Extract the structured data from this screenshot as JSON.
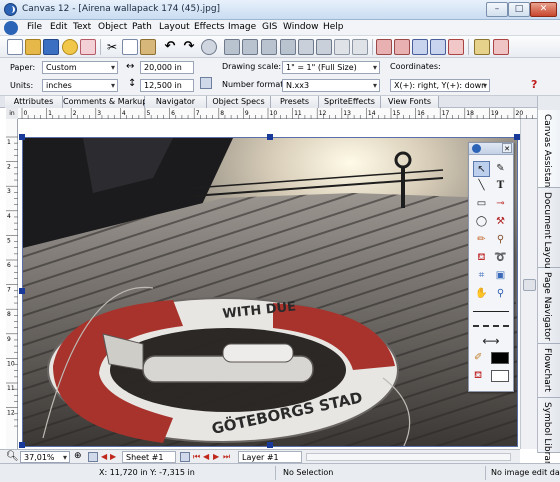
{
  "window": {
    "title": "Canvas 12 - [Airena wallapack 174 (45).jpg]",
    "min": "–",
    "max": "□",
    "close": "✕"
  },
  "menu": [
    "File",
    "Edit",
    "Text",
    "Object",
    "Path",
    "Layout",
    "Effects",
    "Image",
    "GIS",
    "Window",
    "Help"
  ],
  "properties": {
    "paper_label": "Paper:",
    "paper_value": "Custom",
    "units_label": "Units:",
    "units_value": "inches",
    "width_value": "20,000 in",
    "height_value": "12,500 in",
    "drawing_scale_label": "Drawing scale:",
    "drawing_scale_value": "1\" = 1\" (Full Size)",
    "number_format_label": "Number format:",
    "number_format_value": "N.xx3",
    "coordinates_label": "Coordinates:",
    "coordinates_value": "X(+): right, Y(+): down",
    "help_mark": "?"
  },
  "tabs": [
    "Attributes",
    "Comments & Markup",
    "Navigator",
    "Object Specs",
    "Presets",
    "SpriteEffects",
    "View Fonts"
  ],
  "side_tabs": [
    "Canvas Assistant",
    "Document Layout",
    "Page Navigator",
    "Flowchart",
    "Symbol Library"
  ],
  "ruler": {
    "unit": "in",
    "top_ticks": [
      "0",
      "1",
      "2",
      "3",
      "4",
      "5",
      "6",
      "7",
      "8",
      "9",
      "10",
      "11",
      "12",
      "13",
      "14",
      "15",
      "16",
      "17",
      "18",
      "19",
      "20"
    ],
    "left_ticks": [
      "1",
      "2",
      "3",
      "4",
      "5",
      "6",
      "7",
      "8",
      "9",
      "10",
      "11",
      "12"
    ]
  },
  "palette": {
    "close": "✕"
  },
  "nav": {
    "zoom": "37,01%",
    "sheet": "Sheet #1",
    "layer": "Layer #1"
  },
  "status": {
    "coords": "X: 11,720 in Y: -7,315 in",
    "selection": "No Selection",
    "image_info": "No image edit data"
  },
  "photo_text": {
    "ring_top": "WITH DUE",
    "ring_bottom": "GÖTEBORGS STAD"
  },
  "colors": {
    "accent": "#2b63b6",
    "ring_red": "#a8332c"
  }
}
